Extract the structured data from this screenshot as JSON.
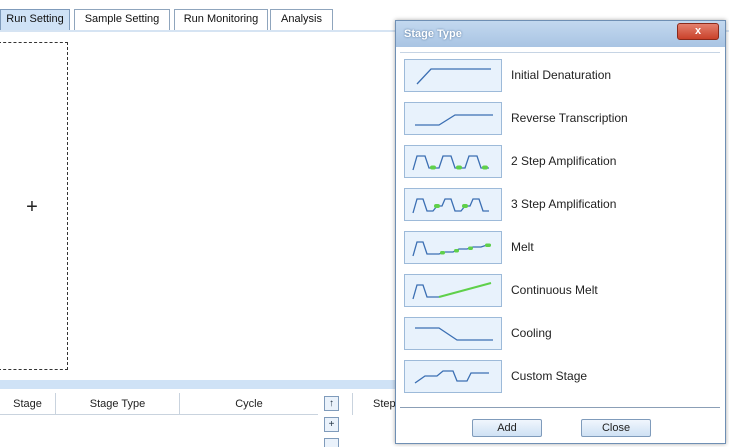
{
  "tabs": [
    {
      "label": "Run Setting",
      "active": true
    },
    {
      "label": "Sample Setting",
      "active": false
    },
    {
      "label": "Run Monitoring",
      "active": false
    },
    {
      "label": "Analysis",
      "active": false
    }
  ],
  "stage_area": {
    "add_symbol": "+"
  },
  "stage_table": {
    "columns": [
      "Stage",
      "Stage Type",
      "Cycle"
    ]
  },
  "side_buttons": {
    "up_symbol": "↑",
    "add_symbol": "+"
  },
  "step_table": {
    "column": "Step"
  },
  "dialog": {
    "title": "Stage Type",
    "close_symbol": "x",
    "stage_types": [
      {
        "label": "Initial Denaturation",
        "icon": "initial-denaturation-icon"
      },
      {
        "label": "Reverse Transcription",
        "icon": "reverse-transcription-icon"
      },
      {
        "label": "2 Step Amplification",
        "icon": "two-step-amplification-icon"
      },
      {
        "label": "3 Step Amplification",
        "icon": "three-step-amplification-icon"
      },
      {
        "label": "Melt",
        "icon": "melt-icon"
      },
      {
        "label": "Continuous Melt",
        "icon": "continuous-melt-icon"
      },
      {
        "label": "Cooling",
        "icon": "cooling-icon"
      },
      {
        "label": "Custom Stage",
        "icon": "custom-stage-icon"
      }
    ],
    "add_label": "Add",
    "close_label": "Close"
  },
  "colors": {
    "accent": "#cfe2f6",
    "icon_line": "#3b6fb3",
    "icon_marker": "#5fd04a",
    "close_button": "#c9412a"
  }
}
